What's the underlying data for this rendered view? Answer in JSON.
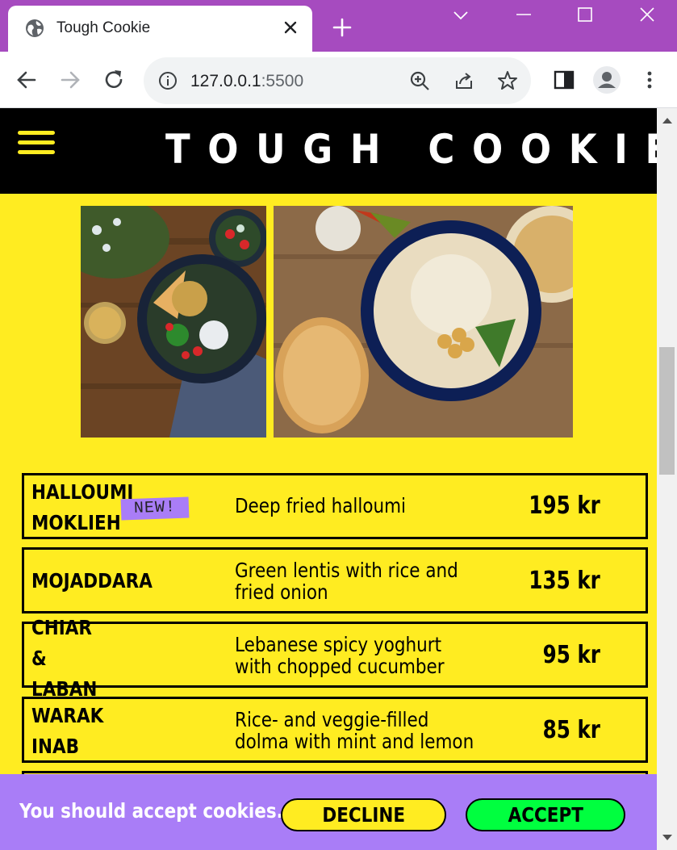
{
  "browser": {
    "tab_title": "Tough Cookie",
    "url_host": "127.0.0.1",
    "url_port": ":5500"
  },
  "site": {
    "brand": "TOUGH COOKIE",
    "colors": {
      "background": "#ffec21",
      "header": "#000000",
      "accent": "#a97df7",
      "accept": "#00ff3f"
    }
  },
  "menu": [
    {
      "name": "HALLOUMI\nMOKLIEH",
      "badge": "NEW!",
      "description": "Deep fried halloumi",
      "price": "195 kr"
    },
    {
      "name": "MOJADDARA",
      "description": "Green lentis with rice and\nfried onion",
      "price": "135 kr"
    },
    {
      "name": "CHIAR\n&\nLABAN",
      "description": "Lebanese spicy yoghurt\nwith chopped cucumber",
      "price": "95 kr"
    },
    {
      "name": "WARAK\nINAB",
      "description": "Rice- and veggie-filled\ndolma with mint and lemon",
      "price": "85 kr"
    }
  ],
  "cookie_banner": {
    "message": "You should accept cookies.",
    "decline_label": "DECLINE",
    "accept_label": "ACCEPT"
  }
}
